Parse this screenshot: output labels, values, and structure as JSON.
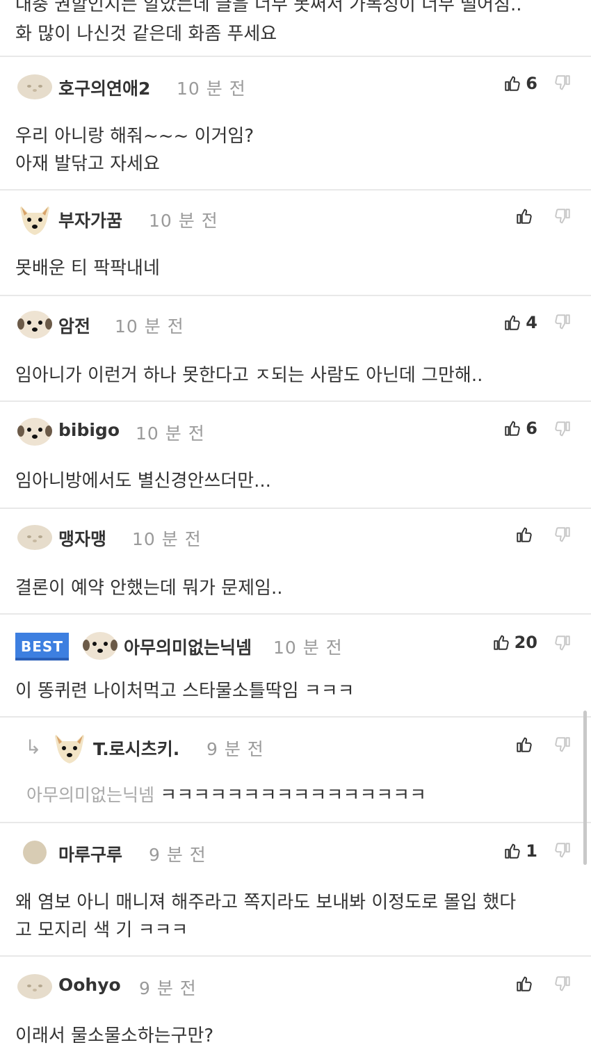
{
  "top": {
    "line1": "대충 권할인지는 알았는데 글을 너무 못써서 가독성이 너무 떨어짐..",
    "line2": "화 많이 나신것 같은데 화좀 푸세요"
  },
  "comments": [
    {
      "nick": "호구의연애2",
      "time": "10 분 전",
      "likes": "6",
      "body": [
        "우리 아니랑 해줘~~~ 이거임?",
        "아재 발닦고 자세요"
      ],
      "avatar": "blob"
    },
    {
      "nick": "부자가꿈",
      "time": "10 분 전",
      "likes": "",
      "body": [
        "못배운 티 팍팍내네"
      ],
      "avatar": "dog"
    },
    {
      "nick": "암전",
      "time": "10 분 전",
      "likes": "4",
      "body": [
        "임아니가 이런거 하나 못한다고 ㅈ되는 사람도 아닌데 그만해.."
      ],
      "avatar": "face"
    },
    {
      "nick": "bibigo",
      "time": "10 분 전",
      "likes": "6",
      "body": [
        "임아니방에서도 별신경안쓰더만..."
      ],
      "avatar": "face"
    },
    {
      "nick": "맹자맹",
      "time": "10 분 전",
      "likes": "",
      "body": [
        "결론이 예약 안했는데 뭐가 문제임.."
      ],
      "avatar": "blob"
    },
    {
      "nick": "아무의미없는닉넴",
      "time": "10 분 전",
      "likes": "20",
      "badge": "BEST",
      "body": [
        "이 똥퀴련 나이처먹고 스타물소틀딱임 ㅋㅋㅋ"
      ],
      "avatar": "face"
    },
    {
      "nick": "T.로시츠키.",
      "time": "9 분 전",
      "likes": "",
      "reply": true,
      "reply_to": "아무의미없는닉넴",
      "body": [
        "ㅋㅋㅋㅋㅋㅋㅋㅋㅋㅋㅋㅋㅋㅋㅋㅋ"
      ],
      "avatar": "dog"
    },
    {
      "nick": "마루구루",
      "time": "9 분 전",
      "likes": "1",
      "body": [
        "왜 염보 아니 매니져 해주라고 쪽지라도 보내봐 이정도로 몰입 했다",
        "고 모지리 색 기 ㅋㅋㅋ"
      ],
      "avatar": "circle"
    },
    {
      "nick": "Oohyo",
      "time": "9 분 전",
      "likes": "",
      "body": [
        "이래서 물소물소하는구만?"
      ],
      "avatar": "blob"
    }
  ],
  "icons": {
    "like": "thumbs-up-icon",
    "dislike": "thumbs-down-icon",
    "reply": "reply-arrow-icon"
  },
  "colors": {
    "best": "#3d7fe0",
    "time": "#9a9a9a",
    "divider": "#e8e8e8"
  }
}
